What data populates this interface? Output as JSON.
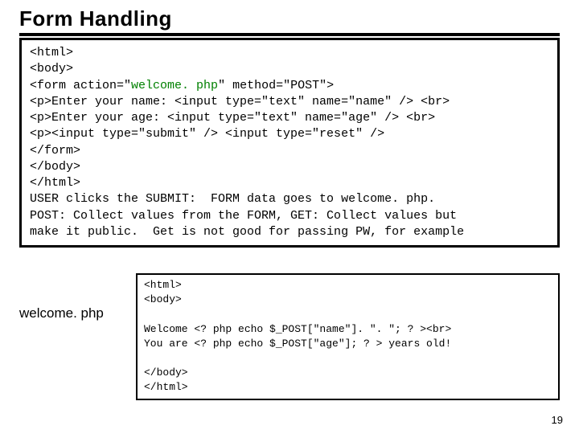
{
  "title": "Form Handling",
  "box1": {
    "l1": "<html>",
    "l2": "<body>",
    "l3a": "<form action=\"",
    "l3b": "welcome. php",
    "l3c": "\" method=\"POST\">",
    "l4": "<p>Enter your name: <input type=\"text\" name=\"name\" /> <br>",
    "l5": "<p>Enter your age: <input type=\"text\" name=\"age\" /> <br>",
    "l6": "<p><input type=\"submit\" /> <input type=\"reset\" />",
    "l7": "</form>",
    "l8": "</body>",
    "l9": "</html>",
    "l10": "USER clicks the SUBMIT:  FORM data goes to welcome. php.",
    "l11": "POST: Collect values from the FORM, GET: Collect values but",
    "l12": "make it public.  Get is not good for passing PW, for example"
  },
  "label": "welcome. php",
  "box2": {
    "l1": "<html>",
    "l2": "<body>",
    "blank1": "",
    "l3": "Welcome <? php echo $_POST[\"name\"]. \". \"; ? ><br>",
    "l4": "You are <? php echo $_POST[\"age\"]; ? > years old!",
    "blank2": "",
    "l5": "</body>",
    "l6": "</html>"
  },
  "pagenum": "19"
}
